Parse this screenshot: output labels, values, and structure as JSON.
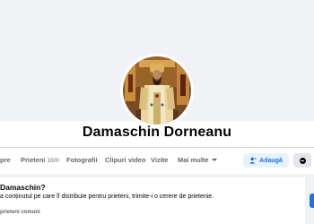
{
  "profile": {
    "name": "Damaschin Dorneanu"
  },
  "tabs": [
    {
      "label": "pre"
    },
    {
      "label": "Prieteni",
      "count": "1000"
    },
    {
      "label": "Fotografii"
    },
    {
      "label": "Clipuri video"
    },
    {
      "label": "Vizite"
    },
    {
      "label": "Mai multe"
    }
  ],
  "actions": {
    "add_label": "Adaugă"
  },
  "privacy_card": {
    "title": "Damaschin?",
    "body": "a conținutul pe care îl distribuie pentru prieteni, trimite-i o cerere de prietenie.",
    "footer": "prieteni comuni"
  },
  "colors": {
    "accent": "#1b74e4",
    "accent_soft": "#e7f3ff",
    "secondary_text": "#65676b",
    "page_bg": "#f0f2f5"
  },
  "icons": {
    "add": "add-friend-icon",
    "more": "more-options-icon"
  }
}
